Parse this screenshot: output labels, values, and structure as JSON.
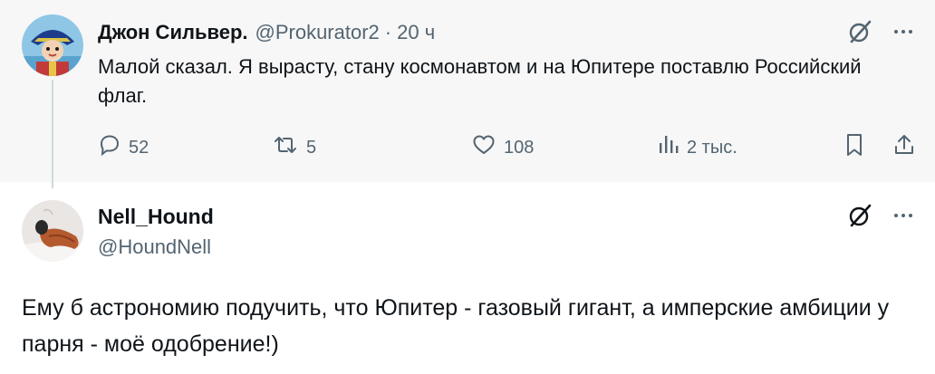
{
  "parent_tweet": {
    "author_name": "Джон Сильвер.",
    "handle": "@Prokurator2",
    "separator": "·",
    "time": "20 ч",
    "text": "Малой сказал. Я вырасту, стану космонавтом и на Юпитере поставлю Российский флаг.",
    "actions": {
      "replies": "52",
      "reposts": "5",
      "likes": "108",
      "views": "2 тыс."
    }
  },
  "reply_tweet": {
    "author_name": "Nell_Hound",
    "handle": "@HoundNell",
    "text": "Ему б астрономию подучить, что Юпитер - газовый гигант, а имперские амбиции у парня - моё одобрение!)"
  },
  "icons": {
    "reply": "speech-bubble-icon",
    "repost": "repost-arrows-icon",
    "like": "heart-icon",
    "views": "bar-chart-icon",
    "bookmark": "bookmark-icon",
    "share": "share-upload-icon",
    "grok": "grok-slash-circle-icon",
    "more": "more-dots-icon"
  },
  "colors": {
    "text_primary": "#0f1419",
    "text_secondary": "#536471",
    "parent_background": "#f7f7f7",
    "thread_line": "#cfd9de"
  }
}
